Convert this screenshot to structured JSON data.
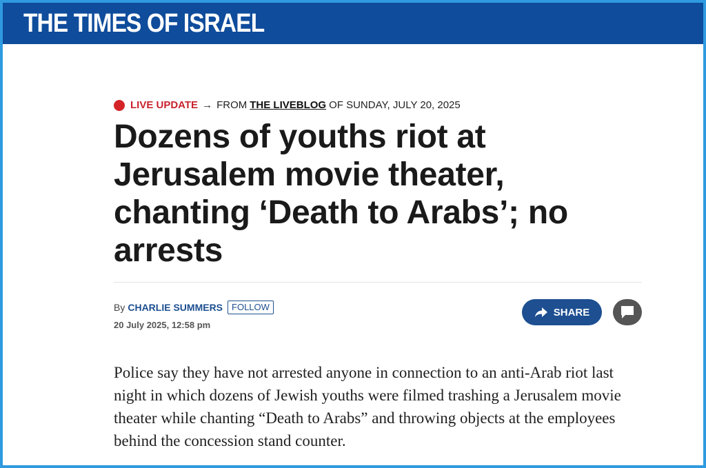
{
  "masthead": {
    "logo_text": "THE TIMES OF ISRAEL"
  },
  "kicker": {
    "live_label": "LIVE UPDATE",
    "arrow": "→",
    "from_text": "FROM",
    "liveblog_link": "THE LIVEBLOG",
    "of_text": "OF SUNDAY, JULY 20, 2025"
  },
  "article": {
    "headline": "Dozens of youths riot at Jerusalem movie theater, chanting ‘Death to Arabs’; no arrests",
    "by_prefix": "By",
    "author": "CHARLIE SUMMERS",
    "follow_label": "FOLLOW",
    "date": "20 July 2025, 12:58 pm",
    "share_label": "SHARE",
    "body": "Police say they have not arrested anyone in connection to an anti-Arab riot last night in which dozens of Jewish youths were filmed trashing a Jerusalem movie theater while chanting “Death to Arabs” and throwing objects at the employees behind the concession stand counter."
  },
  "icons": {
    "live": "live-dot-icon",
    "share": "share-arrow-icon",
    "comment": "comment-bubble-icon"
  },
  "colors": {
    "masthead_bg": "#0f4c9c",
    "live_red": "#c8232c",
    "author_blue": "#1d4f91",
    "frame_border": "#2f9ae0"
  }
}
